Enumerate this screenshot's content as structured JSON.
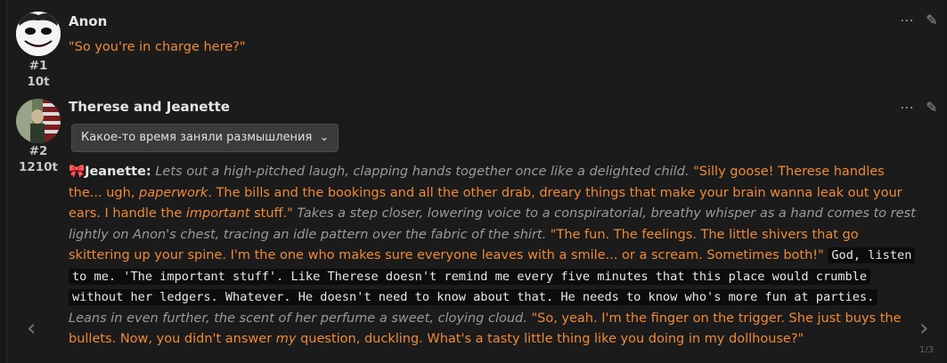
{
  "messages": [
    {
      "name": "Anon",
      "id": "#1",
      "tokens": "10t",
      "text": "\"So you're in charge here?\""
    },
    {
      "name": "Therese and Jeanette",
      "id": "#2",
      "tokens": "1210t",
      "reasoning_label": "Какое-то время заняли размышления",
      "emoji": "🎀",
      "speaker": "Jeanette:",
      "seg": [
        "Lets out a high-pitched laugh, clapping hands together once like a delighted child.",
        "\"Silly goose! Therese handles the... ugh, ",
        "paperwork",
        ". The bills and the bookings and all the other drab, dreary things that make your brain wanna leak out your ears. I handle the ",
        "important",
        " stuff.\"",
        "Takes a step closer, lowering voice to a conspiratorial, breathy whisper as a hand comes to rest lightly on Anon's chest, tracing an idle pattern over the fabric of the shirt.",
        "\"The fun. The feelings. The little shivers that go skittering up your spine. I'm the one who makes sure everyone leaves with a smile... or a scream. Sometimes both!\"",
        "God, listen to me. 'The important stuff'. Like Therese doesn't remind me every five minutes that this place would crumble without her ledgers. Whatever. He doesn't need to know about that. He needs to know who's more fun at parties.",
        "Leans in even further, the scent of her perfume a sweet, cloying cloud.",
        "\"So, yeah. I'm the finger on the trigger. She just buys the bullets. Now, you didn't answer ",
        "my",
        " question, duckling. What's a tasty little thing like you doing in my dollhouse?\""
      ],
      "swipe_counter": "1/3"
    }
  ],
  "icons": {
    "more": "ellipsis-icon",
    "edit": "pencil-icon",
    "chevron_down": "chevron-down-icon",
    "left": "chevron-left-icon",
    "right": "chevron-right-icon"
  },
  "colors": {
    "accent": "#ef8a37",
    "italic": "#9a9a9a",
    "bg": "#1b1b1b"
  }
}
